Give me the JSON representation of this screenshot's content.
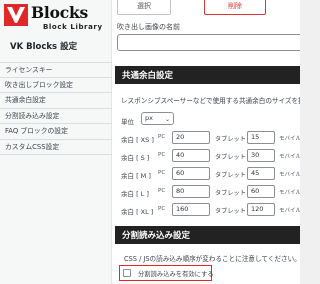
{
  "app": {
    "logo_title": "Blocks",
    "logo_subtitle": "Block Library",
    "caption": "VK Blocks 設定"
  },
  "sidebar": {
    "items": [
      {
        "label": "ライセンスキー"
      },
      {
        "label": "吹き出しブロック設定"
      },
      {
        "label": "共通余白設定"
      },
      {
        "label": "分割読み込み設定"
      },
      {
        "label": "FAQ ブロックの設定"
      },
      {
        "label": "カスタムCSS設定"
      }
    ]
  },
  "balloon": {
    "select_label": "選択",
    "delete_label": "削除",
    "name_label": "吹き出し画像の名前"
  },
  "margin_section": {
    "title": "共通余白設定",
    "description": "レスポンシブスペーサーなどで使用する共通余白のサイズを指",
    "unit_label": "単位",
    "unit_value": "px",
    "rows": [
      {
        "label": "余白 [ XS ]",
        "pc_label": "PC",
        "pc": "20",
        "tablet_label": "タブレット",
        "tablet": "15",
        "mobile_label": "モバイル"
      },
      {
        "label": "余白 [ S ]",
        "pc_label": "PC",
        "pc": "40",
        "tablet_label": "タブレット",
        "tablet": "30",
        "mobile_label": "モバイル"
      },
      {
        "label": "余白 [ M ]",
        "pc_label": "PC",
        "pc": "60",
        "tablet_label": "タブレット",
        "tablet": "45",
        "mobile_label": "モバイル"
      },
      {
        "label": "余白 [ L ]",
        "pc_label": "PC",
        "pc": "80",
        "tablet_label": "タブレット",
        "tablet": "60",
        "mobile_label": "モバイル"
      },
      {
        "label": "余白 [ XL ]",
        "pc_label": "PC",
        "pc": "160",
        "tablet_label": "タブレット",
        "tablet": "120",
        "mobile_label": "モバイル"
      }
    ]
  },
  "split_section": {
    "title": "分割読み込み設定",
    "description": "CSS / JSの読み込み順序が変わることに注意してください。",
    "checkbox_label": "分割読み込みを有効にする",
    "checkbox_checked": false
  },
  "colors": {
    "logo_red": "#e0282a",
    "section_header": "#222222",
    "highlight_border": "#e0282a"
  }
}
